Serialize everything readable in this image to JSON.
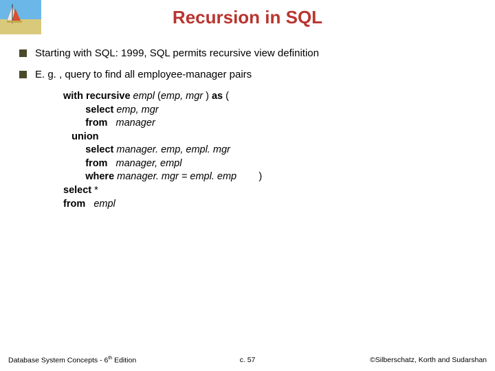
{
  "title": "Recursion in SQL",
  "bullets": [
    "Starting with SQL: 1999, SQL permits recursive view definition",
    "E. g. , query to find all employee-manager pairs"
  ],
  "code": {
    "l1a": "with recursive",
    "l1b": " empl ",
    "l1c": "(",
    "l1d": "emp, mgr ",
    "l1e": ") ",
    "l1f": "as",
    "l1g": " (",
    "l2a": "        select",
    "l2b": " emp, mgr",
    "l3a": "        from",
    "l3b": "   manager",
    "l4a": "   union",
    "l5a": "        select",
    "l5b": " manager. emp, empl. mgr",
    "l6a": "        from",
    "l6b": "   manager, empl",
    "l7a": "        where",
    "l7b": " manager. mgr = empl. emp",
    "l7c": "        )",
    "l8a": "select",
    "l8b": " *",
    "l9a": "from",
    "l9b": "   empl"
  },
  "footer": {
    "left_a": "Database System Concepts - 6",
    "left_sup": "th",
    "left_b": " Edition",
    "center": "c. 57",
    "right": "©Silberschatz, Korth and Sudarshan"
  }
}
